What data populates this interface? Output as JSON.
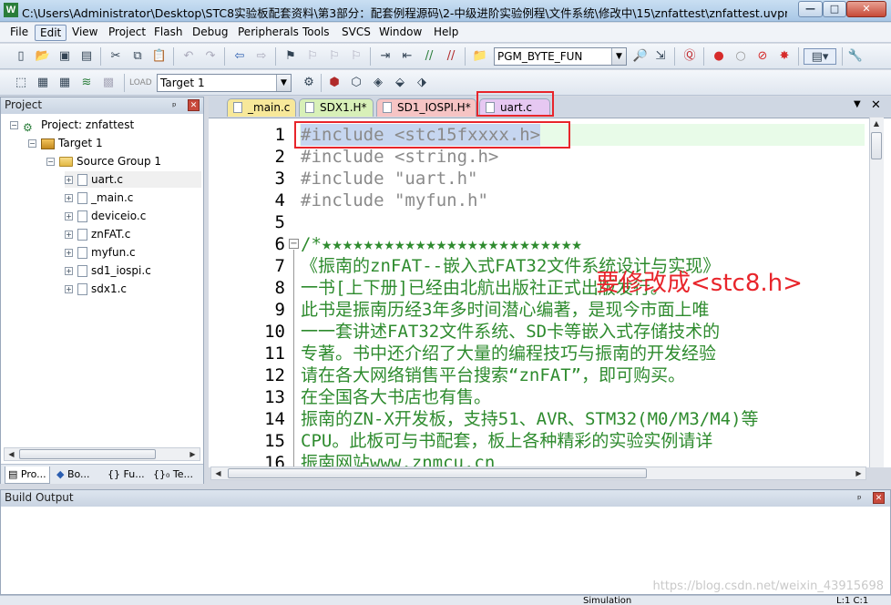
{
  "window": {
    "title": "C:\\Users\\Administrator\\Desktop\\STC8实验板配套资料\\第3部分：配套例程源码\\2-中级进阶实验例程\\文件系统\\修改中\\15\\znfattest\\znfattest.uvproj - µ...",
    "app_icon": "W",
    "min_label": "—",
    "max_label": "□",
    "close_label": "✕"
  },
  "menu": [
    "File",
    "Edit",
    "View",
    "Project",
    "Flash",
    "Debug",
    "Peripherals",
    "Tools",
    "SVCS",
    "Window",
    "Help"
  ],
  "active_menu": "Edit",
  "toolbar": {
    "function_dropdown": "PGM_BYTE_FUN",
    "target_dropdown": "Target 1"
  },
  "project_panel": {
    "title": "Project",
    "project_label": "Project: znfattest",
    "target_label": "Target 1",
    "group_label": "Source Group 1",
    "files": [
      "uart.c",
      "_main.c",
      "deviceio.c",
      "znFAT.c",
      "myfun.c",
      "sd1_iospi.c",
      "sdx1.c"
    ],
    "bottom_tabs": [
      "Pro...",
      "Bo...",
      "{} Fu...",
      "{}₀ Te..."
    ]
  },
  "editor": {
    "tabs": [
      {
        "label": "_main.c",
        "color": "#f7e89a"
      },
      {
        "label": "SDX1.H*",
        "color": "#d8f0b8"
      },
      {
        "label": "SD1_IOSPI.H*",
        "color": "#f6c4c4"
      },
      {
        "label": "uart.c",
        "color": "#e6c8f2"
      }
    ],
    "lines": [
      {
        "n": "1",
        "text": "#include <stc15fxxxx.h>"
      },
      {
        "n": "2",
        "text": "#include <string.h>"
      },
      {
        "n": "3",
        "text": "#include \"uart.h\""
      },
      {
        "n": "4",
        "text": "#include \"myfun.h\""
      },
      {
        "n": "5",
        "text": ""
      },
      {
        "n": "6",
        "text": "/*★★★★★★★★★★★★★★★★★★★★★★★★★"
      },
      {
        "n": "7",
        "text": "  《振南的znFAT--嵌入式FAT32文件系统设计与实现》"
      },
      {
        "n": "8",
        "text": "     一书[上下册]已经由北航出版社正式出版发行。"
      },
      {
        "n": "9",
        "text": "     此书是振南历经3年多时间潜心编著，是现今市面上唯"
      },
      {
        "n": "10",
        "text": "     一一套讲述FAT32文件系统、SD卡等嵌入式存储技术的"
      },
      {
        "n": "11",
        "text": "     专著。书中还介绍了大量的编程技巧与振南的开发经验"
      },
      {
        "n": "12",
        "text": "     请在各大网络销售平台搜索“znFAT”，即可购买。"
      },
      {
        "n": "13",
        "text": "     在全国各大书店也有售。"
      },
      {
        "n": "14",
        "text": "     振南的ZN-X开发板，支持51、AVR、STM32(M0/M3/M4)等"
      },
      {
        "n": "15",
        "text": "     CPU。此板可与书配套，板上各种精彩的实验实例请详"
      },
      {
        "n": "16",
        "text": "     振南网站www.znmcu.cn"
      }
    ],
    "annotation": "要修改成<stc8.h>"
  },
  "build_output": {
    "title": "Build Output"
  },
  "status_bar": {
    "mode": "Simulation",
    "position": "L:1 C:1"
  },
  "watermark": "https://blog.csdn.net/weixin_43915698"
}
